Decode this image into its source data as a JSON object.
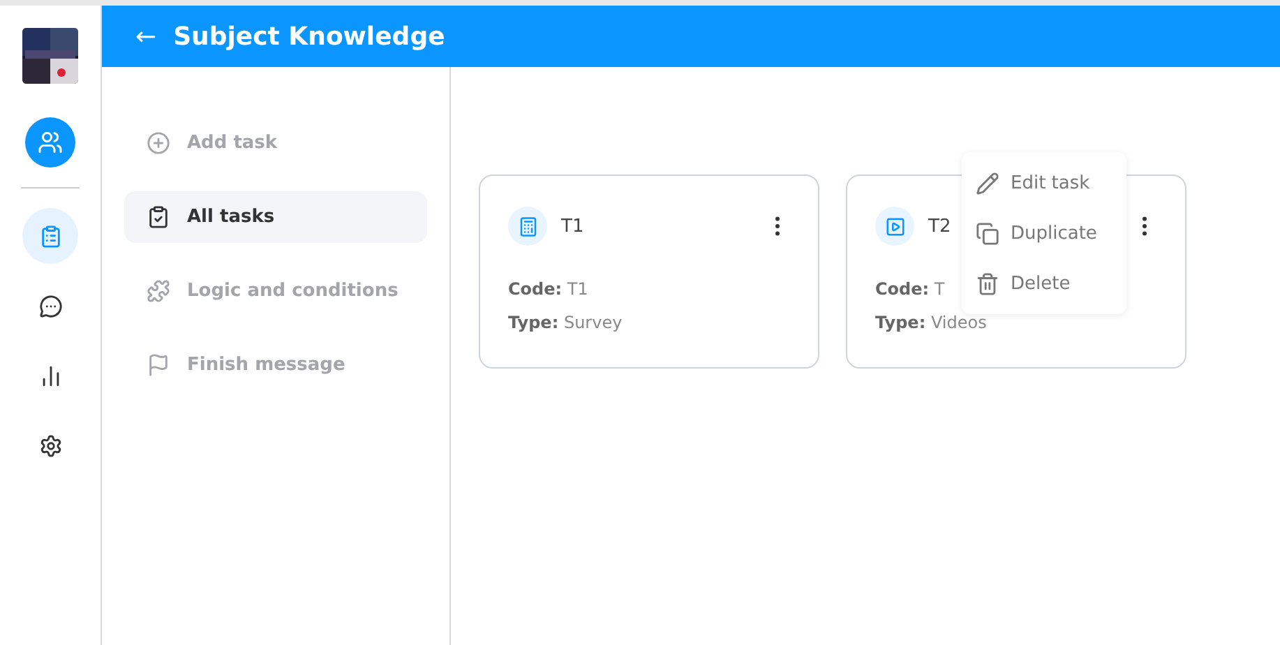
{
  "rail": [
    {
      "selected": true
    },
    {
      "selected": false
    },
    {
      "selected": false
    },
    {
      "selected": false
    }
  ],
  "header": {
    "back": "←",
    "title": "Subject Knowledge"
  },
  "menu": [
    {
      "label": "Add task",
      "selected": false
    },
    {
      "label": "All tasks",
      "selected": true
    },
    {
      "label": "Logic and conditions",
      "selected": false
    },
    {
      "label": "Finish message",
      "selected": false
    }
  ],
  "tasks": [
    {
      "title": "T1",
      "code_label": "Code:",
      "code": "T1",
      "type_label": "Type:",
      "type": "Survey"
    },
    {
      "title": "T2",
      "code_label": "Code:",
      "code": "T",
      "type_label": "Type:",
      "type": "Videos",
      "menu_items": [
        "Edit task",
        "Duplicate",
        "Delete"
      ]
    }
  ]
}
